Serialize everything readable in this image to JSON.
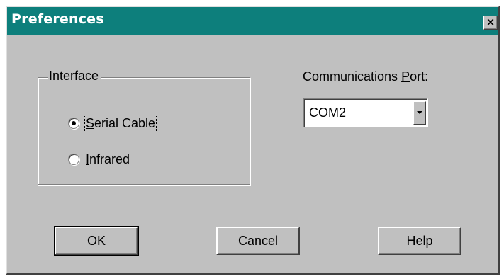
{
  "window": {
    "title": "Preferences",
    "close_glyph": "✕",
    "title_bar_color": "#0d7f7c"
  },
  "interface_group": {
    "legend": "Interface",
    "options": [
      {
        "label_u": "S",
        "label_rest": "erial Cable",
        "selected": true
      },
      {
        "label_u": "I",
        "label_rest": "nfrared",
        "selected": false
      }
    ]
  },
  "port": {
    "label_pre": "Communications ",
    "label_u": "P",
    "label_post": "ort:",
    "value": "COM2"
  },
  "buttons": {
    "ok": "OK",
    "cancel": "Cancel",
    "help_u": "H",
    "help_rest": "elp"
  }
}
